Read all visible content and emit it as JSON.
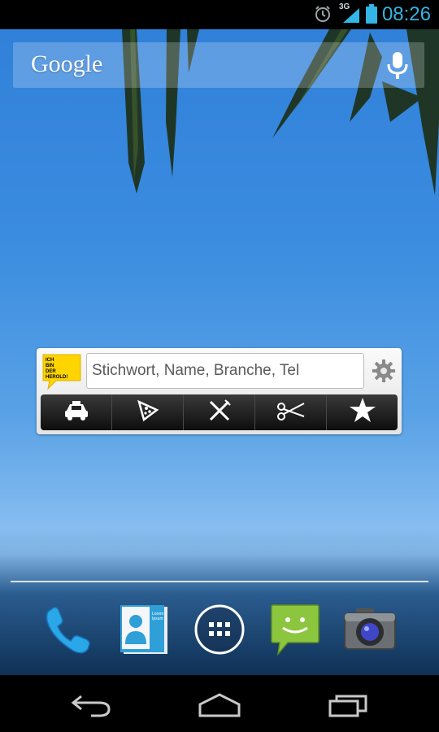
{
  "status_bar": {
    "time": "08:26",
    "network": "3G",
    "icons": [
      "alarm-icon",
      "signal-icon",
      "battery-icon"
    ],
    "accent_color": "#33b5e5"
  },
  "google_search": {
    "logo_text": "Google",
    "icon": "mic-icon"
  },
  "herold_widget": {
    "logo_lines": [
      "ICH",
      "BIN",
      "DER",
      "HEROLD!"
    ],
    "search_placeholder": "Stichwort, Name, Branche, Tel",
    "settings_icon": "gear-icon",
    "categories": [
      {
        "icon": "taxi-icon"
      },
      {
        "icon": "pizza-icon"
      },
      {
        "icon": "cutlery-icon"
      },
      {
        "icon": "scissors-icon"
      },
      {
        "icon": "star-icon"
      }
    ]
  },
  "dock": {
    "apps": [
      {
        "icon": "phone-icon"
      },
      {
        "icon": "contacts-icon",
        "card_text": "Lorem Ipsum"
      },
      {
        "icon": "app-drawer-icon"
      },
      {
        "icon": "messaging-icon"
      },
      {
        "icon": "camera-icon"
      }
    ]
  },
  "nav_bar": {
    "buttons": [
      "back-icon",
      "home-icon",
      "recents-icon"
    ]
  }
}
